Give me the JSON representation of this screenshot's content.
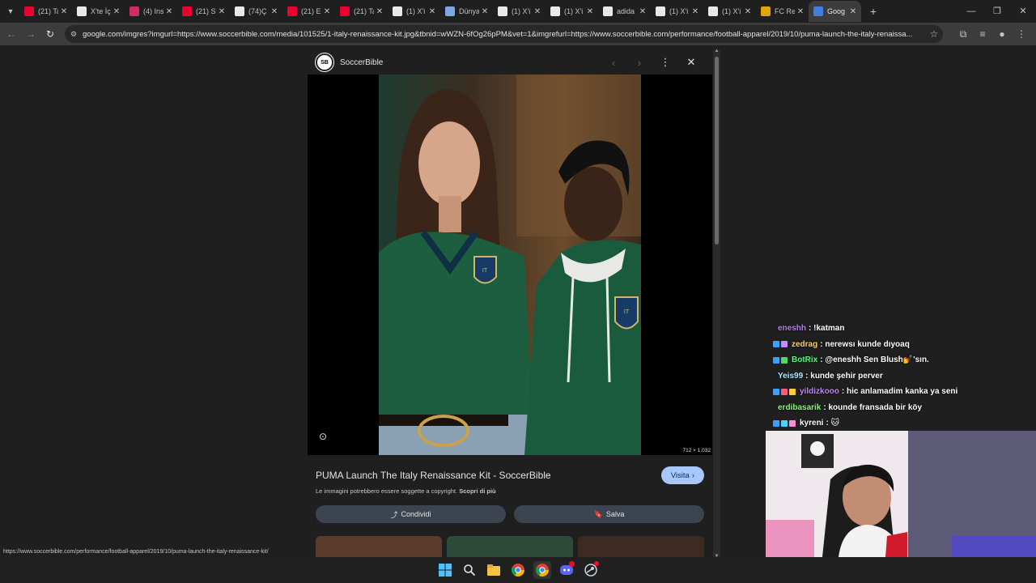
{
  "browser": {
    "tabs": [
      {
        "title": "(21) Ta",
        "icon": "youtube-icon",
        "color": "#ff0033"
      },
      {
        "title": "X'te İç",
        "icon": "x-icon",
        "color": "#ffffff"
      },
      {
        "title": "(4) Ins",
        "icon": "instagram-icon",
        "color": "#e1306c"
      },
      {
        "title": "(21) St",
        "icon": "youtube-icon",
        "color": "#ff0033"
      },
      {
        "title": "(74)Ç",
        "icon": "tiktok-icon",
        "color": "#ffffff"
      },
      {
        "title": "(21) E",
        "icon": "youtube-icon",
        "color": "#ff0033"
      },
      {
        "title": "(21) Ta",
        "icon": "youtube-icon",
        "color": "#ff0033"
      },
      {
        "title": "(1) X'i",
        "icon": "x-icon",
        "color": "#ffffff"
      },
      {
        "title": "Dünya",
        "icon": "globe-icon",
        "color": "#8ab4f8"
      },
      {
        "title": "(1) X'i",
        "icon": "x-icon",
        "color": "#ffffff"
      },
      {
        "title": "(1) X'i",
        "icon": "x-icon",
        "color": "#ffffff"
      },
      {
        "title": "adida",
        "icon": "adidas-icon",
        "color": "#ffffff"
      },
      {
        "title": "(1) X'i",
        "icon": "x-icon",
        "color": "#ffffff"
      },
      {
        "title": "(1) X'i",
        "icon": "x-icon",
        "color": "#ffffff"
      },
      {
        "title": "FC Re",
        "icon": "fc-icon",
        "color": "#f4b400"
      },
      {
        "title": "Goog",
        "icon": "google-icon",
        "color": "#4285f4",
        "active": true
      }
    ],
    "url": "google.com/imgres?imgurl=https://www.soccerbible.com/media/101525/1-italy-renaissance-kit.jpg&tbnid=wWZN-6fOg26pPM&vet=1&imgrefurl=https://www.soccerbible.com/performance/football-apparel/2019/10/puma-launch-the-italy-renaissa...",
    "status_url": "https://www.soccerbible.com/performance/football-apparel/2019/10/puma-launch-the-italy-renaissance-kit/"
  },
  "viewer": {
    "source_name": "SoccerBible",
    "source_logo_text": "SB",
    "image_dims": "712 × 1.032",
    "title": "PUMA Launch The Italy Renaissance Kit - SoccerBible",
    "visit_label": "Visita",
    "copyright_note": "Le immagini potrebbero essere soggette a copyright.",
    "learn_more": "Scopri di più",
    "share_label": "Condividi",
    "save_label": "Salva"
  },
  "chat": [
    {
      "user": "eneshh",
      "color": "#b57cff",
      "message": ": !katman",
      "badges": []
    },
    {
      "user": "zedrag",
      "color": "#ffd34d",
      "message": ": nerewsı kunde dıyoaq",
      "badges": [
        "#3aa0ff",
        "#c08cff"
      ]
    },
    {
      "user": "BotRix",
      "color": "#4cff7a",
      "message": ": @eneshh Sen Blush💅'sın.",
      "badges": [
        "#3aa0ff",
        "#4cd964"
      ]
    },
    {
      "user": "Yeis99",
      "color": "#aee8ff",
      "message": ": kunde şehir perver",
      "badges": []
    },
    {
      "user": "yildizkooo",
      "color": "#c77dff",
      "message": ": hic anlamadim kanka ya seni",
      "badges": [
        "#3aa0ff",
        "#ff5a7a",
        "#ffcc33"
      ]
    },
    {
      "user": "erdibasarik",
      "color": "#7cff6b",
      "message": ": kounde fransada bir köy",
      "badges": []
    },
    {
      "user": "kyreni",
      "color": "#ffffff",
      "message": ": 🐱",
      "badges": [
        "#3aa0ff",
        "#4dd2ff",
        "#ff8ad8"
      ]
    }
  ],
  "taskbar": [
    {
      "name": "windows-start-icon"
    },
    {
      "name": "search-icon"
    },
    {
      "name": "file-explorer-icon"
    },
    {
      "name": "chrome-icon"
    },
    {
      "name": "chrome-active-icon"
    },
    {
      "name": "discord-icon"
    },
    {
      "name": "steam-icon"
    }
  ]
}
